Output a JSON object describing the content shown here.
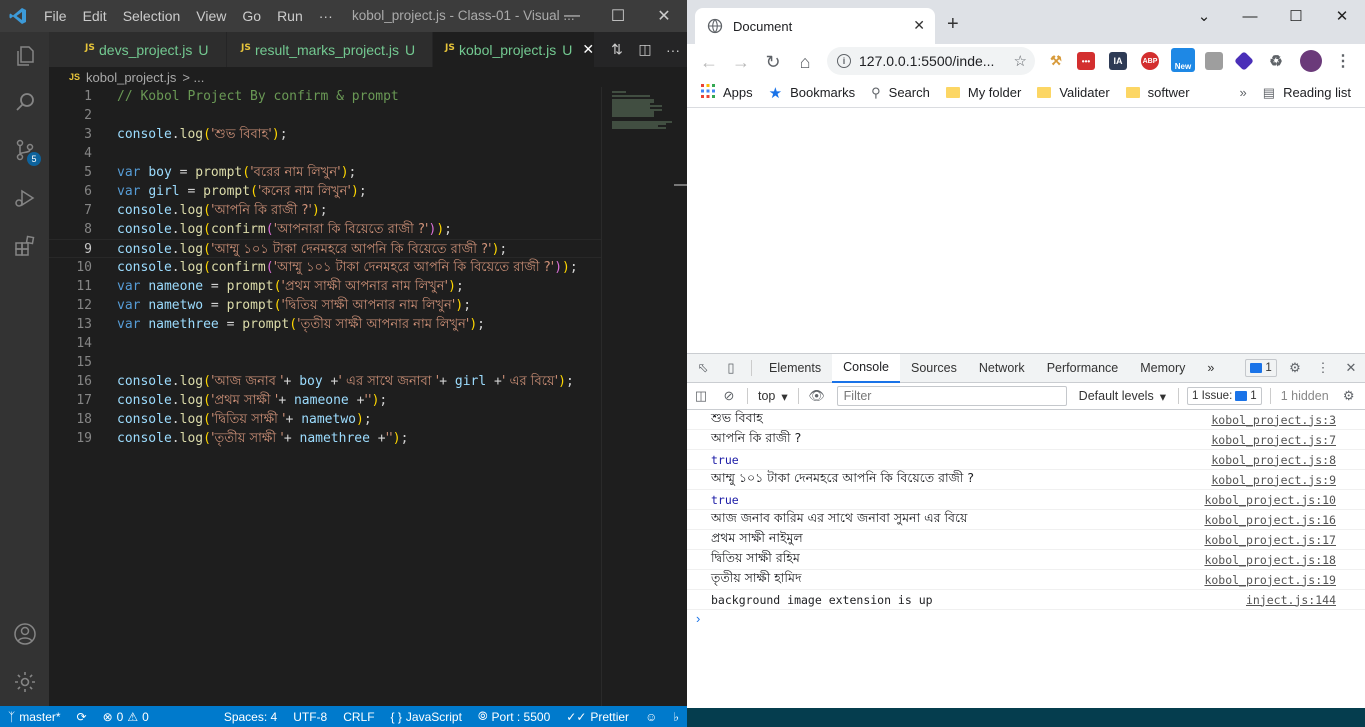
{
  "vscode": {
    "menu": [
      "File",
      "Edit",
      "Selection",
      "View",
      "Go",
      "Run",
      "···"
    ],
    "window_title": "kobol_project.js - Class-01 - Visual ...",
    "scm_badge": "5",
    "tabs": [
      {
        "name": "devs_project.js",
        "mod": "U",
        "active": false
      },
      {
        "name": "result_marks_project.js",
        "mod": "U",
        "active": false
      },
      {
        "name": "kobol_project.js",
        "mod": "U",
        "active": true
      }
    ],
    "js_badge": "JS",
    "breadcrumb": {
      "file": "kobol_project.js",
      "rest": "> ..."
    },
    "current_line": 9,
    "code": [
      {
        "n": "1",
        "t": [
          [
            "comment",
            "// Kobol Project By confirm & prompt"
          ]
        ]
      },
      {
        "n": "2",
        "t": []
      },
      {
        "n": "3",
        "t": [
          [
            "var",
            "console"
          ],
          [
            "plain",
            "."
          ],
          [
            "fn",
            "log"
          ],
          [
            "br1",
            "("
          ],
          [
            "str",
            "'শুভ বিবাহ'"
          ],
          [
            "br1",
            ")"
          ],
          [
            "plain",
            ";"
          ]
        ]
      },
      {
        "n": "4",
        "t": []
      },
      {
        "n": "5",
        "t": [
          [
            "kw",
            "var "
          ],
          [
            "var",
            "boy"
          ],
          [
            "plain",
            " = "
          ],
          [
            "fn",
            "prompt"
          ],
          [
            "br1",
            "("
          ],
          [
            "str",
            "'বরের নাম লিখুন'"
          ],
          [
            "br1",
            ")"
          ],
          [
            "plain",
            ";"
          ]
        ]
      },
      {
        "n": "6",
        "t": [
          [
            "kw",
            "var "
          ],
          [
            "var",
            "girl"
          ],
          [
            "plain",
            " = "
          ],
          [
            "fn",
            "prompt"
          ],
          [
            "br1",
            "("
          ],
          [
            "str",
            "'কনের নাম লিখুন'"
          ],
          [
            "br1",
            ")"
          ],
          [
            "plain",
            ";"
          ]
        ]
      },
      {
        "n": "7",
        "t": [
          [
            "var",
            "console"
          ],
          [
            "plain",
            "."
          ],
          [
            "fn",
            "log"
          ],
          [
            "br1",
            "("
          ],
          [
            "str",
            "'আপনি কি রাজী ?'"
          ],
          [
            "br1",
            ")"
          ],
          [
            "plain",
            ";"
          ]
        ]
      },
      {
        "n": "8",
        "t": [
          [
            "var",
            "console"
          ],
          [
            "plain",
            "."
          ],
          [
            "fn",
            "log"
          ],
          [
            "br1",
            "("
          ],
          [
            "fn",
            "confirm"
          ],
          [
            "br2",
            "("
          ],
          [
            "str",
            "'আপনারা কি বিয়েতে রাজী ?'"
          ],
          [
            "br2",
            ")"
          ],
          [
            "br1",
            ")"
          ],
          [
            "plain",
            ";"
          ]
        ]
      },
      {
        "n": "9",
        "t": [
          [
            "var",
            "console"
          ],
          [
            "plain",
            "."
          ],
          [
            "fn",
            "log"
          ],
          [
            "br1",
            "("
          ],
          [
            "str",
            "'আম্মু ১০১ টাকা দেনমহরে আপনি কি বিয়েতে রাজী ?'"
          ],
          [
            "br1",
            ")"
          ],
          [
            "plain",
            ";"
          ]
        ]
      },
      {
        "n": "10",
        "t": [
          [
            "var",
            "console"
          ],
          [
            "plain",
            "."
          ],
          [
            "fn",
            "log"
          ],
          [
            "br1",
            "("
          ],
          [
            "fn",
            "confirm"
          ],
          [
            "br2",
            "("
          ],
          [
            "str",
            "'আম্মু ১০১ টাকা দেনমহরে আপনি কি বিয়েতে রাজী ?'"
          ],
          [
            "br2",
            ")"
          ],
          [
            "br1",
            ")"
          ],
          [
            "plain",
            ";"
          ]
        ]
      },
      {
        "n": "11",
        "t": [
          [
            "kw",
            "var "
          ],
          [
            "var",
            "nameone"
          ],
          [
            "plain",
            " = "
          ],
          [
            "fn",
            "prompt"
          ],
          [
            "br1",
            "("
          ],
          [
            "str",
            "'প্রথম সাক্ষী আপনার নাম লিখুন'"
          ],
          [
            "br1",
            ")"
          ],
          [
            "plain",
            ";"
          ]
        ]
      },
      {
        "n": "12",
        "t": [
          [
            "kw",
            "var "
          ],
          [
            "var",
            "nametwo"
          ],
          [
            "plain",
            " = "
          ],
          [
            "fn",
            "prompt"
          ],
          [
            "br1",
            "("
          ],
          [
            "str",
            "'দ্বিতিয় সাক্ষী আপনার নাম লিখুন'"
          ],
          [
            "br1",
            ")"
          ],
          [
            "plain",
            ";"
          ]
        ]
      },
      {
        "n": "13",
        "t": [
          [
            "kw",
            "var "
          ],
          [
            "var",
            "namethree"
          ],
          [
            "plain",
            " = "
          ],
          [
            "fn",
            "prompt"
          ],
          [
            "br1",
            "("
          ],
          [
            "str",
            "'তৃতীয় সাক্ষী আপনার নাম লিখুন'"
          ],
          [
            "br1",
            ")"
          ],
          [
            "plain",
            ";"
          ]
        ]
      },
      {
        "n": "14",
        "t": []
      },
      {
        "n": "15",
        "t": []
      },
      {
        "n": "16",
        "t": [
          [
            "var",
            "console"
          ],
          [
            "plain",
            "."
          ],
          [
            "fn",
            "log"
          ],
          [
            "br1",
            "("
          ],
          [
            "str",
            "'আজ জনাব '"
          ],
          [
            "plain",
            "+ "
          ],
          [
            "var",
            "boy"
          ],
          [
            "plain",
            " +"
          ],
          [
            "str",
            "' এর সাথে জনাবা '"
          ],
          [
            "plain",
            "+ "
          ],
          [
            "var",
            "girl"
          ],
          [
            "plain",
            " +"
          ],
          [
            "str",
            "' এর বিয়ে'"
          ],
          [
            "br1",
            ")"
          ],
          [
            "plain",
            ";"
          ]
        ]
      },
      {
        "n": "17",
        "t": [
          [
            "var",
            "console"
          ],
          [
            "plain",
            "."
          ],
          [
            "fn",
            "log"
          ],
          [
            "br1",
            "("
          ],
          [
            "str",
            "'প্রথম সাক্ষী '"
          ],
          [
            "plain",
            "+ "
          ],
          [
            "var",
            "nameone"
          ],
          [
            "plain",
            " +"
          ],
          [
            "str",
            "''"
          ],
          [
            "br1",
            ")"
          ],
          [
            "plain",
            ";"
          ]
        ]
      },
      {
        "n": "18",
        "t": [
          [
            "var",
            "console"
          ],
          [
            "plain",
            "."
          ],
          [
            "fn",
            "log"
          ],
          [
            "br1",
            "("
          ],
          [
            "str",
            "'দ্বিতিয় সাক্ষী '"
          ],
          [
            "plain",
            "+ "
          ],
          [
            "var",
            "nametwo"
          ],
          [
            "br1",
            ")"
          ],
          [
            "plain",
            ";"
          ]
        ]
      },
      {
        "n": "19",
        "t": [
          [
            "var",
            "console"
          ],
          [
            "plain",
            "."
          ],
          [
            "fn",
            "log"
          ],
          [
            "br1",
            "("
          ],
          [
            "str",
            "'তৃতীয় সাক্ষী '"
          ],
          [
            "plain",
            "+ "
          ],
          [
            "var",
            "namethree"
          ],
          [
            "plain",
            " +"
          ],
          [
            "str",
            "''"
          ],
          [
            "br1",
            ")"
          ],
          [
            "plain",
            ";"
          ]
        ]
      }
    ],
    "status": {
      "branch": "master*",
      "errors": "0",
      "warnings": "0",
      "spaces": "Spaces: 4",
      "encoding": "UTF-8",
      "eol": "CRLF",
      "language": "JavaScript",
      "port": "Port : 5500",
      "prettier": "Prettier"
    }
  },
  "chrome": {
    "tab_title": "Document",
    "url": "127.0.0.1:5500/inde...",
    "ext_new_label": "New",
    "ext_ia_label": "IA",
    "ext_abp_label": "ABP",
    "bookmarks": [
      "Apps",
      "Bookmarks",
      "Search",
      "My folder",
      "Validater",
      "softwer"
    ],
    "reading_list": "Reading list",
    "devtools": {
      "tabs": [
        "Elements",
        "Console",
        "Sources",
        "Network",
        "Performance",
        "Memory"
      ],
      "active_tab": "Console",
      "tab_more": "»",
      "messages_count": "1",
      "context": "top",
      "filter_placeholder": "Filter",
      "levels": "Default levels",
      "issues": "1 Issue:",
      "issues_count": "1",
      "hidden": "1 hidden",
      "logs": [
        {
          "msg": "শুভ বিবাহ",
          "src": "kobol_project.js:3",
          "kind": "text"
        },
        {
          "msg": "আপনি কি রাজী ?",
          "src": "kobol_project.js:7",
          "kind": "text"
        },
        {
          "msg": "true",
          "src": "kobol_project.js:8",
          "kind": "bool"
        },
        {
          "msg": "আম্মু ১০১ টাকা দেনমহরে আপনি কি বিয়েতে রাজী ?",
          "src": "kobol_project.js:9",
          "kind": "text"
        },
        {
          "msg": "true",
          "src": "kobol_project.js:10",
          "kind": "bool"
        },
        {
          "msg": "আজ জনাব কারিম এর সাথে জনাবা সুমনা এর বিয়ে",
          "src": "kobol_project.js:16",
          "kind": "text"
        },
        {
          "msg": "প্রথম সাক্ষী নাইমুল",
          "src": "kobol_project.js:17",
          "kind": "text"
        },
        {
          "msg": "দ্বিতিয় সাক্ষী রহিম",
          "src": "kobol_project.js:18",
          "kind": "text"
        },
        {
          "msg": "তৃতীয় সাক্ষী হামিদ",
          "src": "kobol_project.js:19",
          "kind": "text"
        },
        {
          "msg": "background image extension is up",
          "src": "inject.js:144",
          "kind": "mono"
        }
      ]
    }
  }
}
